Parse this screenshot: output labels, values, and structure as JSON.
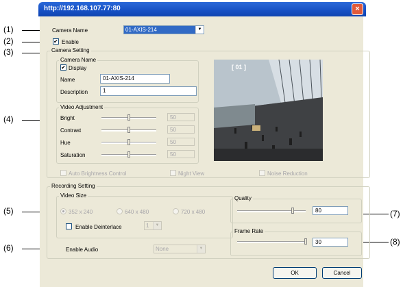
{
  "window": {
    "title": "http://192.168.107.77:80",
    "close": "×"
  },
  "callouts": [
    "(1)",
    "(2)",
    "(3)",
    "(4)",
    "(5)",
    "(6)",
    "(7)",
    "(8)"
  ],
  "top": {
    "camera_name_label": "Camera Name",
    "camera_name_value": "01-AXIS-214",
    "enable_label": "Enable",
    "enable_checked": "✔"
  },
  "camera_setting": {
    "label": "Camera Setting",
    "camera_name_group": "Camera Name",
    "display_label": "Display",
    "display_checked": "✔",
    "name_label": "Name",
    "name_value": "01-AXIS-214",
    "description_label": "Description",
    "description_value": "1",
    "video_adjustment": "Video Adjustment",
    "sliders": [
      {
        "label": "Bright",
        "value": "50"
      },
      {
        "label": "Contrast",
        "value": "50"
      },
      {
        "label": "Hue",
        "value": "50"
      },
      {
        "label": "Saturation",
        "value": "50"
      }
    ],
    "auto_brightness": "Auto Brightness Control",
    "night_view": "Night View",
    "noise_reduction": "Noise Reduction",
    "preview_overlay": "[ 01 ]"
  },
  "recording_setting": {
    "label": "Recording Setting",
    "video_size": "Video Size",
    "sizes": [
      "352 x 240",
      "640 x 480",
      "720 x 480"
    ],
    "enable_deinterlace": "Enable Deinterlace",
    "deinterlace_value": "1",
    "enable_audio": "Enable Audio",
    "audio_value": "None",
    "quality": "Quality",
    "quality_value": "80",
    "quality_level": 0.8,
    "frame_rate": "Frame Rate",
    "frame_rate_value": "30",
    "frame_rate_level": 1.0
  },
  "buttons": {
    "ok": "OK",
    "cancel": "Cancel"
  }
}
